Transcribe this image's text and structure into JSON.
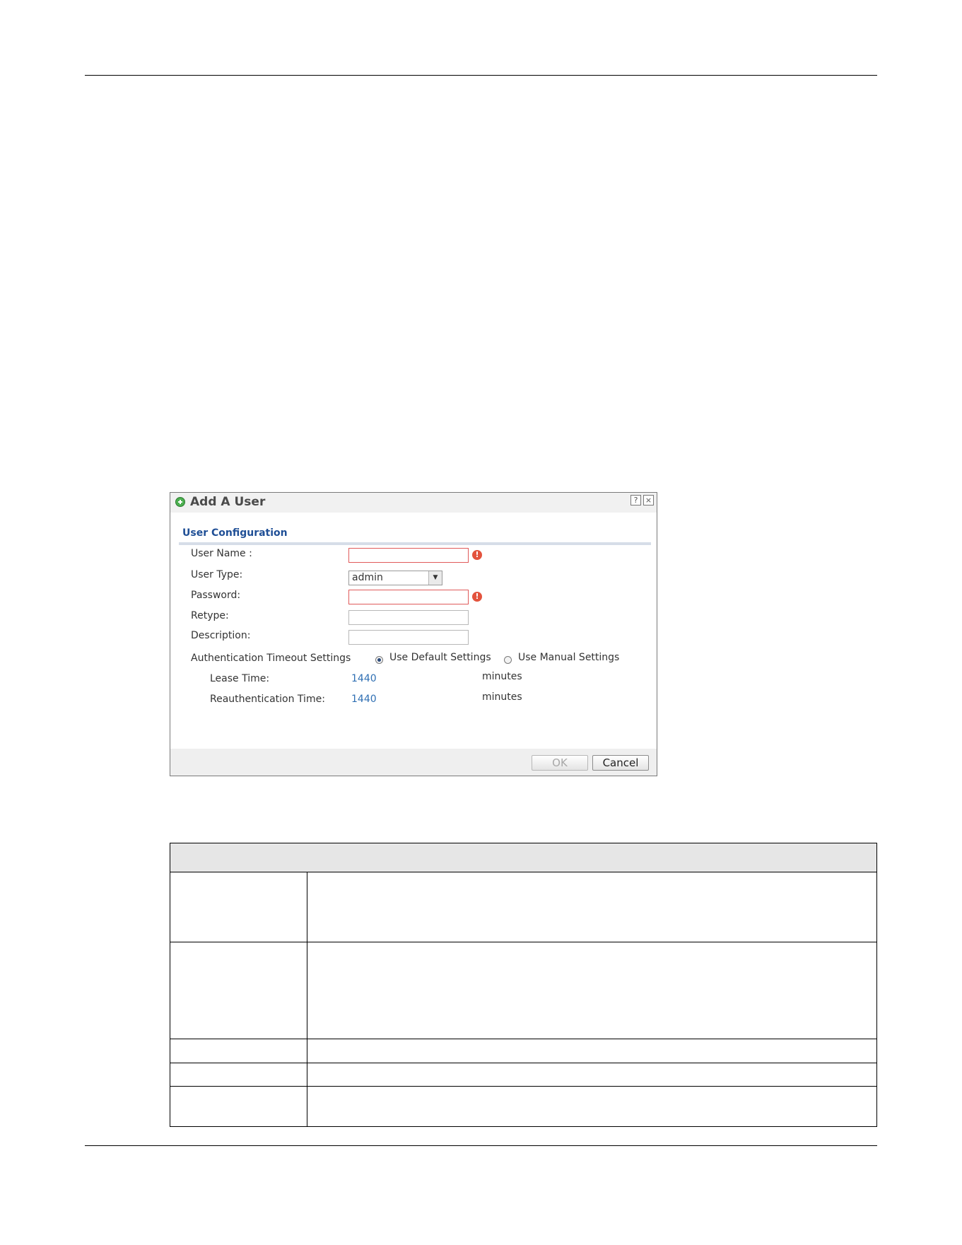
{
  "dialog": {
    "title": "Add A User",
    "help_glyph": "?",
    "close_glyph": "×",
    "section_title": "User Configuration",
    "fields": {
      "user_name": {
        "label": "User Name :",
        "value": ""
      },
      "user_type": {
        "label": "User Type:",
        "value": "admin"
      },
      "password": {
        "label": "Password:",
        "value": ""
      },
      "retype": {
        "label": "Retype:",
        "value": ""
      },
      "description": {
        "label": "Description:",
        "value": ""
      }
    },
    "error_glyph": "!",
    "auth_timeout": {
      "label": "Authentication Timeout Settings",
      "option_default": "Use Default Settings",
      "option_manual": "Use Manual Settings",
      "lease_time": {
        "label": "Lease Time:",
        "value": "1440",
        "unit": "minutes"
      },
      "reauth_time": {
        "label": "Reauthentication Time:",
        "value": "1440",
        "unit": "minutes"
      }
    },
    "buttons": {
      "ok": "OK",
      "cancel": "Cancel"
    }
  },
  "colors": {
    "accent_blue": "#1f4f96",
    "value_blue": "#2f6fb3",
    "error_red": "#e3533d",
    "add_green": "#4caf50"
  }
}
